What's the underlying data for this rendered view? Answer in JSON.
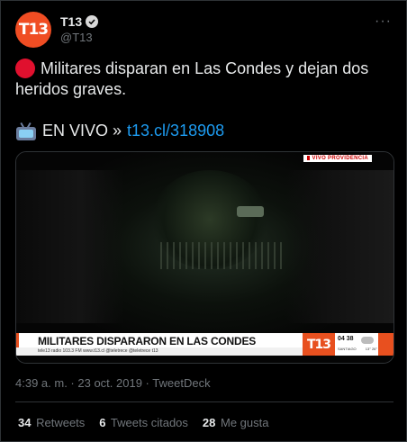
{
  "author": {
    "name": "T13",
    "handle": "@T13",
    "avatar_text": "T13"
  },
  "tweet": {
    "text": "Militares disparan en Las Condes y dejan dos heridos graves.",
    "live_prefix": "EN VIVO »",
    "link": "t13.cl/318908"
  },
  "media": {
    "live_tag": "VIVO PROVIDENCIA",
    "headline": "MILITARES DISPARARON EN LAS CONDES",
    "ticker": "tele13 radio 103.3 FM    www.t13.cl    @teletrece    @teletrece    t13",
    "brand": "T13",
    "clock": "04 38",
    "city": "SANTIAGO",
    "temp": "13° 26°"
  },
  "meta": {
    "time": "4:39 a. m.",
    "date": "23 oct. 2019",
    "source": "TweetDeck"
  },
  "stats": {
    "retweets_count": "34",
    "retweets_label": "Retweets",
    "quotes_count": "6",
    "quotes_label": "Tweets citados",
    "likes_count": "28",
    "likes_label": "Me gusta"
  },
  "more_icon": "ellipsis-icon",
  "colors": {
    "accent": "#1d9bf0",
    "brand": "#f04d23",
    "dot": "#e0102e"
  }
}
